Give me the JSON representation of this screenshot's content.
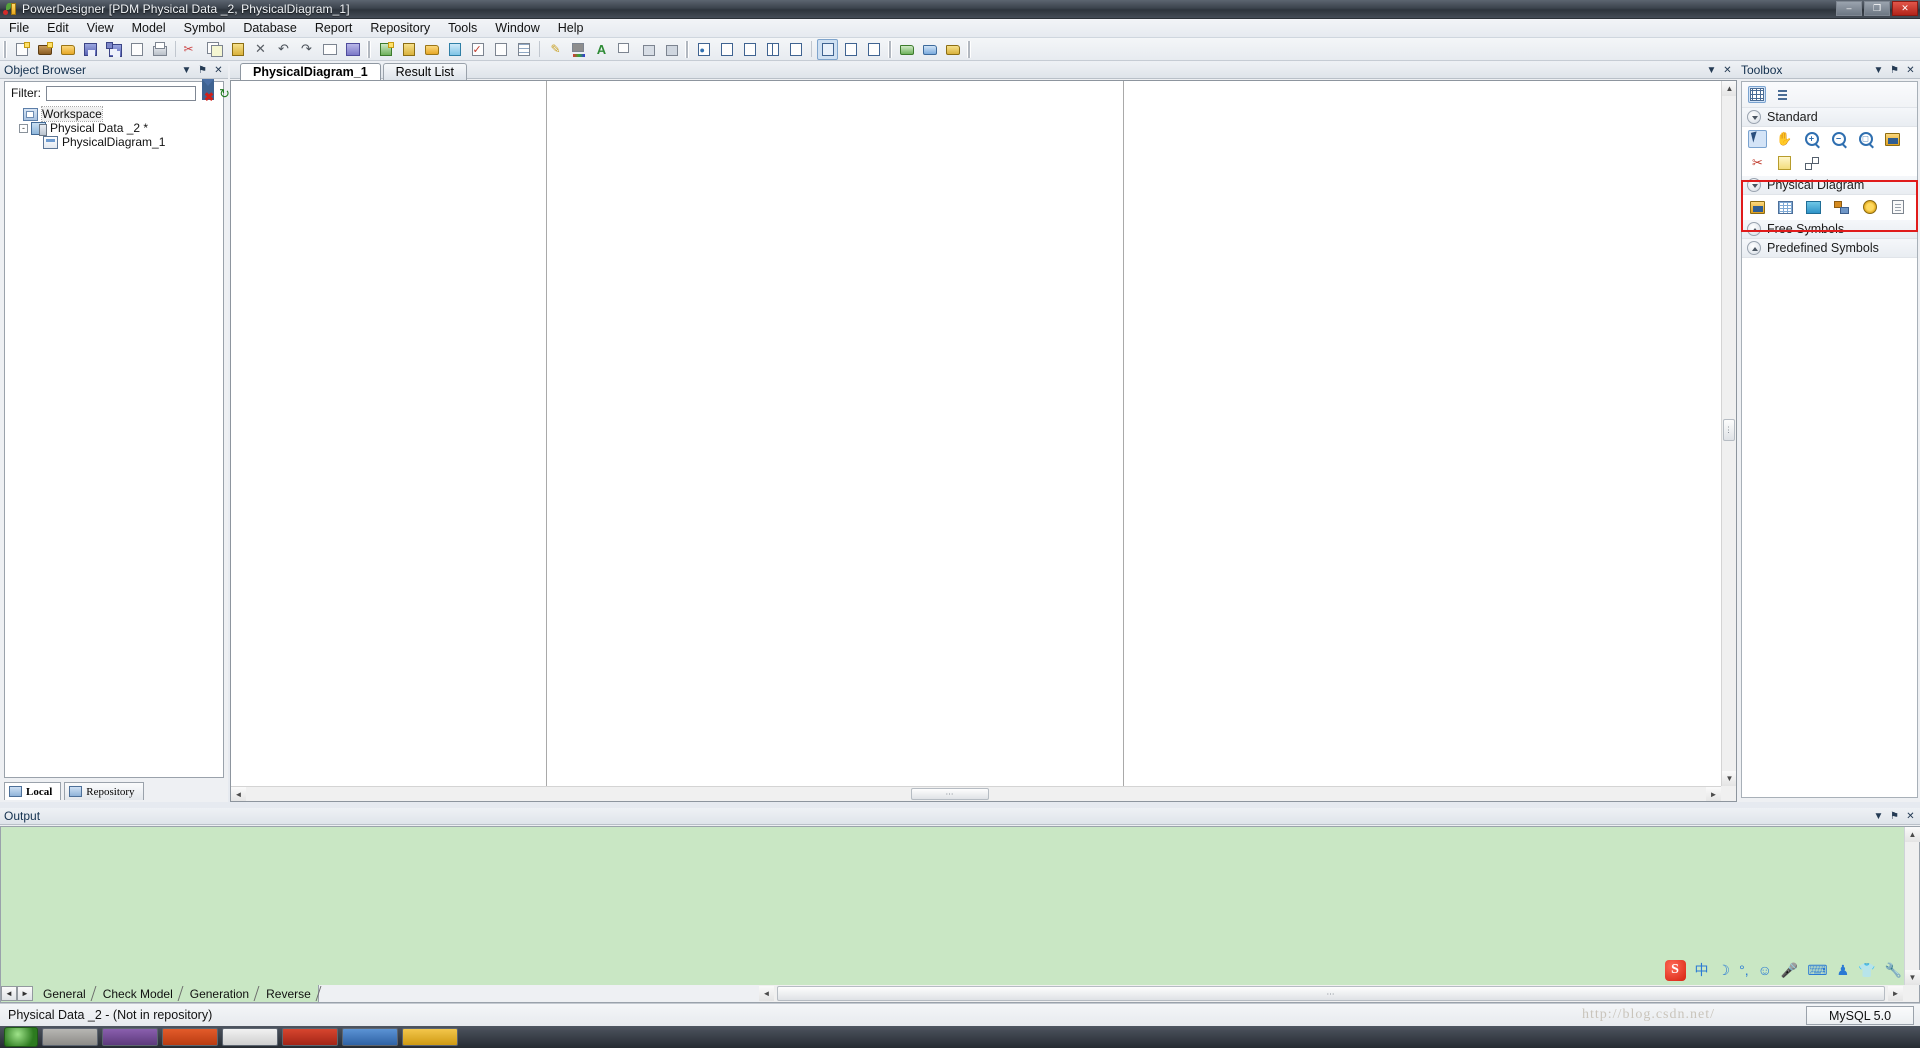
{
  "window": {
    "title": "PowerDesigner [PDM Physical Data _2, PhysicalDiagram_1]",
    "minimize_label": "–",
    "restore_label": "❐",
    "close_label": "✕",
    "app_icon": "powerdesigner-icon"
  },
  "menubar": {
    "items": [
      {
        "label": "File"
      },
      {
        "label": "Edit"
      },
      {
        "label": "View"
      },
      {
        "label": "Model"
      },
      {
        "label": "Symbol"
      },
      {
        "label": "Database"
      },
      {
        "label": "Report"
      },
      {
        "label": "Repository"
      },
      {
        "label": "Tools"
      },
      {
        "label": "Window"
      },
      {
        "label": "Help"
      }
    ]
  },
  "toolbar": {
    "groups": [
      {
        "name": "file-group",
        "buttons": [
          {
            "icon": "new-model-icon",
            "glyph": "new"
          },
          {
            "icon": "new-package-icon",
            "glyph": "pkg"
          },
          {
            "icon": "open-icon",
            "glyph": "folder"
          },
          {
            "icon": "save-icon",
            "glyph": "disk"
          },
          {
            "icon": "save-all-icon",
            "glyph": "disks"
          },
          {
            "icon": "print-preview-icon",
            "glyph": "preview"
          },
          {
            "icon": "print-icon",
            "glyph": "printer"
          },
          {
            "icon": "cut-icon",
            "glyph": "scissors"
          },
          {
            "icon": "copy-icon",
            "glyph": "copy"
          },
          {
            "icon": "paste-icon",
            "glyph": "paste"
          },
          {
            "icon": "delete-icon",
            "glyph": "x"
          },
          {
            "icon": "undo-icon",
            "glyph": "undo"
          },
          {
            "icon": "redo-icon",
            "glyph": "redo"
          },
          {
            "icon": "properties-icon",
            "glyph": "props"
          },
          {
            "icon": "help-icon",
            "glyph": "book"
          }
        ]
      },
      {
        "name": "model-group",
        "buttons": [
          {
            "icon": "new-diagram-icon",
            "glyph": "newdiag"
          },
          {
            "icon": "list-objects-icon",
            "glyph": "list"
          },
          {
            "icon": "model-options-icon",
            "glyph": "options"
          },
          {
            "icon": "generate-database-icon",
            "glyph": "gendb"
          },
          {
            "icon": "check-model-icon",
            "glyph": "check"
          },
          {
            "icon": "page-icon",
            "glyph": "page"
          },
          {
            "icon": "grid-icon",
            "glyph": "grid"
          },
          {
            "icon": "format-brush-icon",
            "glyph": "brush"
          },
          {
            "icon": "fill-color-icon",
            "glyph": "fill"
          },
          {
            "icon": "font-color-icon",
            "glyph": "font"
          },
          {
            "icon": "bring-to-front-icon",
            "glyph": "front"
          },
          {
            "icon": "send-backward-icon",
            "glyph": "back"
          },
          {
            "icon": "send-to-back-icon",
            "glyph": "back2"
          }
        ]
      },
      {
        "name": "window-group",
        "buttons": [
          {
            "icon": "zoom-fit-icon",
            "glyph": "fit"
          },
          {
            "icon": "zoom-selection-icon",
            "glyph": "zsel"
          },
          {
            "icon": "window-single-icon",
            "glyph": "win1"
          },
          {
            "icon": "window-split-icon",
            "glyph": "win2"
          },
          {
            "icon": "window-overview-icon",
            "glyph": "win3"
          },
          {
            "icon": "view-normal-icon",
            "glyph": "vn"
          },
          {
            "icon": "view-preview-icon",
            "glyph": "vp"
          },
          {
            "icon": "view-list-icon",
            "glyph": "vl"
          },
          {
            "icon": "browser-icon",
            "glyph": "br"
          },
          {
            "icon": "output-icon",
            "glyph": "ou"
          },
          {
            "icon": "result-icon",
            "glyph": "rs"
          }
        ]
      }
    ]
  },
  "object_browser": {
    "title": "Object Browser",
    "menu_glyph": "▼",
    "pin_glyph": "⚑",
    "close_glyph": "✕",
    "filter": {
      "label": "Filter:",
      "value": "",
      "placeholder": "",
      "clear_icon": "clear-filter-icon",
      "refresh_icon": "refresh-icon"
    },
    "tree": [
      {
        "label": "Workspace",
        "icon": "workspace-icon",
        "level": 0,
        "expander": "",
        "selected": true
      },
      {
        "label": "Physical Data _2 *",
        "icon": "model-icon",
        "level": 1,
        "expander": "-",
        "selected": false
      },
      {
        "label": "PhysicalDiagram_1",
        "icon": "diagram-icon",
        "level": 2,
        "expander": "",
        "selected": false
      }
    ],
    "tabs": [
      {
        "label": "Local",
        "icon": "local-icon",
        "active": true
      },
      {
        "label": "Repository",
        "icon": "repository-icon",
        "active": false
      }
    ]
  },
  "diagram": {
    "tabs": [
      {
        "label": "PhysicalDiagram_1",
        "active": true
      },
      {
        "label": "Result List",
        "active": false
      }
    ],
    "head_menu_glyph": "▼",
    "head_close_glyph": "✕",
    "page_break_positions": [
      315,
      892
    ],
    "hscroll": {
      "left_arrow": "◄",
      "right_arrow": "►",
      "thumb_grip": "⋯"
    },
    "vscroll": {
      "up_arrow": "▲",
      "down_arrow": "▼",
      "thumb_grip": "⋮"
    }
  },
  "toolbox": {
    "title": "Toolbox",
    "menu_glyph": "▼",
    "pin_glyph": "⚑",
    "close_glyph": "✕",
    "top_tools": [
      {
        "icon": "palette-grid-icon",
        "selected": true
      },
      {
        "icon": "palette-list-icon",
        "selected": false
      }
    ],
    "groups": [
      {
        "name": "Standard",
        "expanded": true,
        "highlighted": false,
        "tools": [
          {
            "icon": "pointer-icon",
            "selected": true
          },
          {
            "icon": "grabber-hand-icon",
            "selected": false
          },
          {
            "icon": "zoom-in-icon",
            "selected": false
          },
          {
            "icon": "zoom-out-icon",
            "selected": false
          },
          {
            "icon": "zoom-area-icon",
            "selected": false
          },
          {
            "icon": "open-package-diagram-icon",
            "selected": false
          },
          {
            "icon": "delete-scissors-icon",
            "selected": false
          },
          {
            "icon": "note-icon",
            "selected": false
          },
          {
            "icon": "link-icon",
            "selected": false
          }
        ]
      },
      {
        "name": "Physical Diagram",
        "expanded": true,
        "highlighted": true,
        "tools": [
          {
            "icon": "package-icon",
            "selected": false
          },
          {
            "icon": "table-icon",
            "selected": false
          },
          {
            "icon": "view-icon",
            "selected": false
          },
          {
            "icon": "reference-icon",
            "selected": false
          },
          {
            "icon": "procedure-icon",
            "selected": false
          },
          {
            "icon": "file-icon",
            "selected": false
          }
        ]
      },
      {
        "name": "Free Symbols",
        "expanded": false,
        "highlighted": false,
        "tools": []
      },
      {
        "name": "Predefined Symbols",
        "expanded": false,
        "highlighted": false,
        "tools": []
      }
    ]
  },
  "output": {
    "title": "Output",
    "menu_glyph": "▼",
    "pin_glyph": "⚑",
    "close_glyph": "✕",
    "text": "",
    "nav_prev": "◄",
    "nav_next": "►",
    "tabs": [
      {
        "label": "General",
        "active": true
      },
      {
        "label": "Check Model",
        "active": false
      },
      {
        "label": "Generation",
        "active": false
      },
      {
        "label": "Reverse",
        "active": false
      }
    ],
    "hscroll_grip": "⋯"
  },
  "tray": {
    "items": [
      {
        "icon": "sogou-ime-icon",
        "label": "S"
      },
      {
        "icon": "chinese-mode-icon",
        "label": "中"
      },
      {
        "icon": "moon-icon",
        "label": "☽"
      },
      {
        "icon": "punctuation-icon",
        "label": "°,"
      },
      {
        "icon": "emoji-icon",
        "label": "☺"
      },
      {
        "icon": "microphone-icon",
        "label": "Ἲ4"
      },
      {
        "icon": "keyboard-icon",
        "label": "⌨"
      },
      {
        "icon": "user-icon",
        "label": "♟"
      },
      {
        "icon": "skin-icon",
        "label": "ὅ5"
      },
      {
        "icon": "wrench-icon",
        "label": "ὒ7"
      }
    ]
  },
  "statusbar": {
    "text": "Physical Data _2 - (Not in repository)",
    "dbms": "MySQL 5.0",
    "watermark": "http://blog.csdn.net/"
  },
  "taskbar": {
    "start_icon": "start-orb-icon",
    "items": [
      {
        "icon": "task-app-1"
      },
      {
        "icon": "task-app-2"
      },
      {
        "icon": "task-app-3"
      },
      {
        "icon": "task-app-4"
      },
      {
        "icon": "task-app-5"
      },
      {
        "icon": "task-app-6"
      },
      {
        "icon": "task-app-7"
      }
    ]
  },
  "colors": {
    "accent": "#2f6fb0",
    "highlight_box": "#e01b1b",
    "output_bg": "#c9e7c4",
    "titlebar": "#3b434d"
  }
}
